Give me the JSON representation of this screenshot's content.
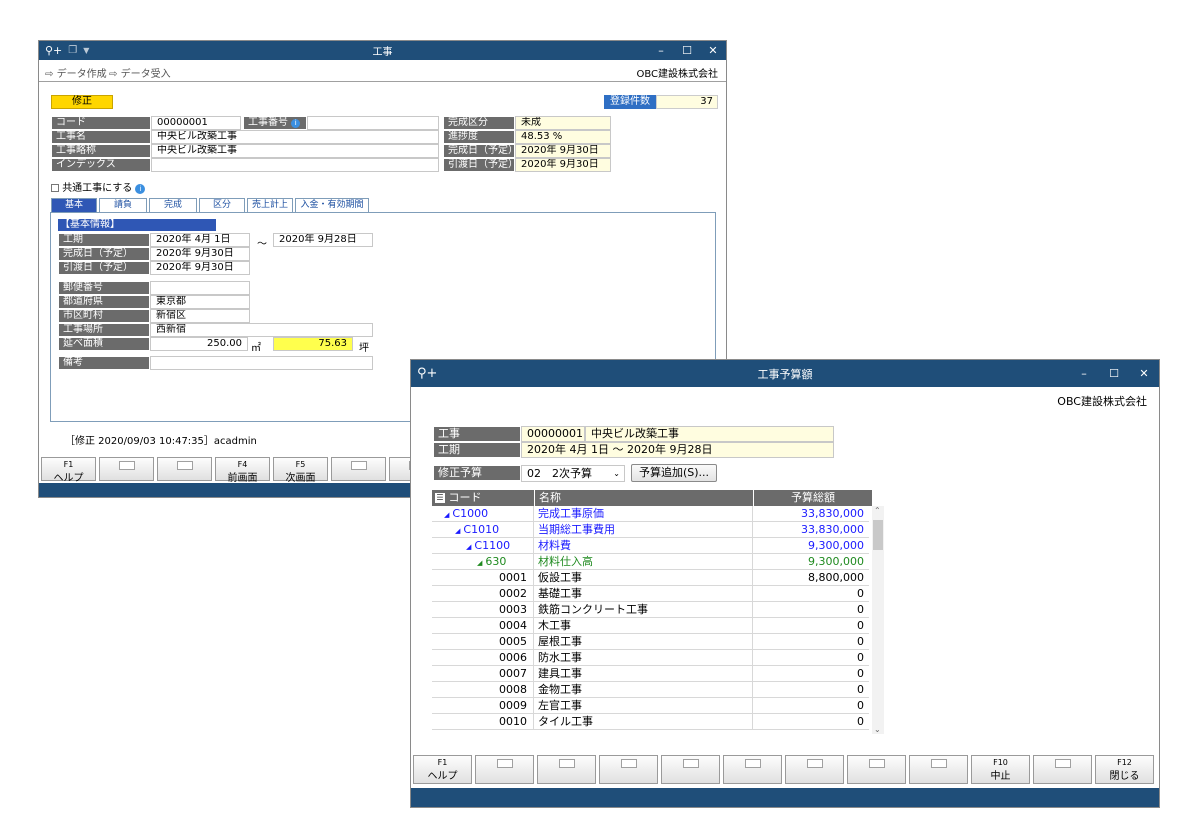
{
  "win1": {
    "title": "工事",
    "toolbar": {
      "create_label": "データ作成",
      "receive_label": "データ受入"
    },
    "company": "OBC建設株式会社",
    "mode_badge": "修正",
    "count_label": "登録件数",
    "count_value": "37",
    "fields": {
      "code_label": "コード",
      "code_value": "00000001",
      "kojibango_label": "工事番号",
      "name_label": "工事名",
      "name_value": "中央ビル改築工事",
      "short_label": "工事略称",
      "short_value": "中央ビル改築工事",
      "index_label": "インデックス",
      "index_value": "",
      "status_label": "完成区分",
      "status_value": "未成",
      "progress_label": "進捗度",
      "progress_value": "48.53 %",
      "complete_label": "完成日（予定）",
      "complete_value": "2020年 9月30日",
      "handover_label": "引渡日（予定）",
      "handover_value": "2020年 9月30日"
    },
    "common_label": "共通工事にする",
    "tabs": [
      "基本",
      "請負",
      "完成",
      "区分",
      "売上計上",
      "入金・有効期間"
    ],
    "basic": {
      "section": "【基本情報】",
      "period_label": "工期",
      "period_from": "2020年 4月 1日",
      "tilde": "～",
      "period_to": "2020年 9月28日",
      "complete_label": "完成日（予定）",
      "complete_value": "2020年 9月30日",
      "handover_label": "引渡日（予定）",
      "handover_value": "2020年 9月30日",
      "zip_label": "郵便番号",
      "zip_value": "",
      "pref_label": "都道府県",
      "pref_value": "東京都",
      "city_label": "市区町村",
      "city_value": "新宿区",
      "site_label": "工事場所",
      "site_value": "西新宿",
      "area_label": "延べ面積",
      "area_value": "250.00",
      "area_unit1": "㎡",
      "area_tsubo": "75.63",
      "area_unit2": "坪",
      "note_label": "備考",
      "note_value": ""
    },
    "status_line": "［修正 2020/09/03 10:47:35］acadmin",
    "fkeys": [
      {
        "fn": "F1",
        "label": "ヘルプ"
      },
      {
        "fn": "",
        "label": ""
      },
      {
        "fn": "",
        "label": ""
      },
      {
        "fn": "F4",
        "label": "前画面"
      },
      {
        "fn": "F5",
        "label": "次画面"
      },
      {
        "fn": "",
        "label": ""
      },
      {
        "fn": "",
        "label": ""
      }
    ]
  },
  "win2": {
    "title": "工事予算額",
    "company": "OBC建設株式会社",
    "koji_label": "工事",
    "koji_code": "00000001",
    "koji_name": "中央ビル改築工事",
    "period_label": "工期",
    "period_value": "2020年 4月 1日 ～ 2020年 9月28日",
    "revision_label": "修正予算",
    "revision_value": "02　2次予算",
    "add_budget_label": "予算追加(S)...",
    "grid_headers": {
      "code": "コード",
      "name": "名称",
      "total": "予算総額"
    },
    "rows": [
      {
        "code": "C1000",
        "name": "完成工事原価",
        "amount": "33,830,000",
        "level": 0,
        "color": "blue",
        "expand": true
      },
      {
        "code": "C1010",
        "name": "当期総工事費用",
        "amount": "33,830,000",
        "level": 1,
        "color": "blue",
        "expand": true
      },
      {
        "code": "C1100",
        "name": "材料費",
        "amount": "9,300,000",
        "level": 2,
        "color": "blue",
        "expand": true
      },
      {
        "code": "630",
        "name": "材料仕入高",
        "amount": "9,300,000",
        "level": 3,
        "color": "green",
        "expand": true
      },
      {
        "code": "0001",
        "name": "仮設工事",
        "amount": "8,800,000",
        "level": 4,
        "color": "black",
        "expand": false
      },
      {
        "code": "0002",
        "name": "基礎工事",
        "amount": "0",
        "level": 4,
        "color": "black",
        "expand": false
      },
      {
        "code": "0003",
        "name": "鉄筋コンクリート工事",
        "amount": "0",
        "level": 4,
        "color": "black",
        "expand": false
      },
      {
        "code": "0004",
        "name": "木工事",
        "amount": "0",
        "level": 4,
        "color": "black",
        "expand": false
      },
      {
        "code": "0005",
        "name": "屋根工事",
        "amount": "0",
        "level": 4,
        "color": "black",
        "expand": false
      },
      {
        "code": "0006",
        "name": "防水工事",
        "amount": "0",
        "level": 4,
        "color": "black",
        "expand": false
      },
      {
        "code": "0007",
        "name": "建具工事",
        "amount": "0",
        "level": 4,
        "color": "black",
        "expand": false
      },
      {
        "code": "0008",
        "name": "金物工事",
        "amount": "0",
        "level": 4,
        "color": "black",
        "expand": false
      },
      {
        "code": "0009",
        "name": "左官工事",
        "amount": "0",
        "level": 4,
        "color": "black",
        "expand": false
      },
      {
        "code": "0010",
        "name": "タイル工事",
        "amount": "0",
        "level": 4,
        "color": "black",
        "expand": false
      }
    ],
    "fkeys": [
      {
        "fn": "F1",
        "label": "ヘルプ"
      },
      {
        "fn": "",
        "label": ""
      },
      {
        "fn": "",
        "label": ""
      },
      {
        "fn": "",
        "label": ""
      },
      {
        "fn": "",
        "label": ""
      },
      {
        "fn": "",
        "label": ""
      },
      {
        "fn": "",
        "label": ""
      },
      {
        "fn": "",
        "label": ""
      },
      {
        "fn": "",
        "label": ""
      },
      {
        "fn": "F10",
        "label": "中止"
      },
      {
        "fn": "",
        "label": ""
      },
      {
        "fn": "F12",
        "label": "閉じる"
      }
    ]
  }
}
